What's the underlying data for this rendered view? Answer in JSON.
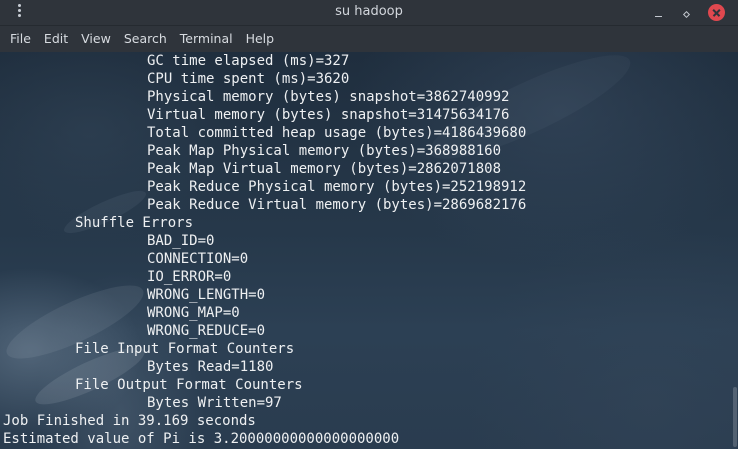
{
  "window": {
    "title": "su hadoop"
  },
  "menubar": {
    "items": [
      "File",
      "Edit",
      "View",
      "Search",
      "Terminal",
      "Help"
    ]
  },
  "terminal": {
    "lines": [
      {
        "indent": 2,
        "text": "GC time elapsed (ms)=327"
      },
      {
        "indent": 2,
        "text": "CPU time spent (ms)=3620"
      },
      {
        "indent": 2,
        "text": "Physical memory (bytes) snapshot=3862740992"
      },
      {
        "indent": 2,
        "text": "Virtual memory (bytes) snapshot=31475634176"
      },
      {
        "indent": 2,
        "text": "Total committed heap usage (bytes)=4186439680"
      },
      {
        "indent": 2,
        "text": "Peak Map Physical memory (bytes)=368988160"
      },
      {
        "indent": 2,
        "text": "Peak Map Virtual memory (bytes)=2862071808"
      },
      {
        "indent": 2,
        "text": "Peak Reduce Physical memory (bytes)=252198912"
      },
      {
        "indent": 2,
        "text": "Peak Reduce Virtual memory (bytes)=2869682176"
      },
      {
        "indent": 1,
        "text": "Shuffle Errors"
      },
      {
        "indent": 2,
        "text": "BAD_ID=0"
      },
      {
        "indent": 2,
        "text": "CONNECTION=0"
      },
      {
        "indent": 2,
        "text": "IO_ERROR=0"
      },
      {
        "indent": 2,
        "text": "WRONG_LENGTH=0"
      },
      {
        "indent": 2,
        "text": "WRONG_MAP=0"
      },
      {
        "indent": 2,
        "text": "WRONG_REDUCE=0"
      },
      {
        "indent": 1,
        "text": "File Input Format Counters"
      },
      {
        "indent": 2,
        "text": "Bytes Read=1180"
      },
      {
        "indent": 1,
        "text": "File Output Format Counters"
      },
      {
        "indent": 2,
        "text": "Bytes Written=97"
      },
      {
        "indent": 0,
        "text": "Job Finished in 39.169 seconds"
      },
      {
        "indent": 0,
        "text": "Estimated value of Pi is 3.20000000000000000000"
      }
    ]
  },
  "colors": {
    "titlebar": "#2f343b",
    "close_button": "#e0484f",
    "terminal_text": "#eef0f2"
  },
  "icons": {
    "app_menu": "vertical-dots-icon",
    "minimize": "minimize-icon",
    "maximize": "maximize-icon",
    "close": "close-icon"
  }
}
